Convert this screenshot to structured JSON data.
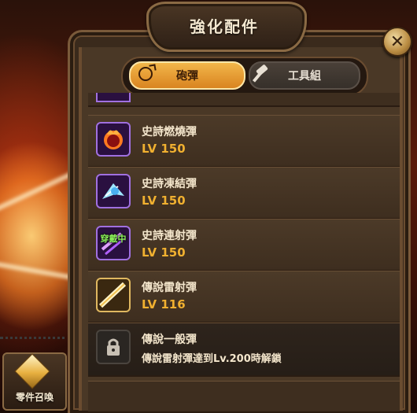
{
  "panel": {
    "title": "強化配件",
    "close_label": "✕"
  },
  "tabs": [
    {
      "label": "砲彈",
      "active": true,
      "icon": "cannonball-icon"
    },
    {
      "label": "工具組",
      "active": false,
      "icon": "hammer-icon"
    }
  ],
  "items": [
    {
      "name": "史詩燃燒彈",
      "level": "LV 150",
      "rarity": "epic",
      "icon": "burning-shell-icon"
    },
    {
      "name": "史詩凍結彈",
      "level": "LV 150",
      "rarity": "epic",
      "icon": "freezing-shell-icon"
    },
    {
      "name": "史詩連射彈",
      "level": "LV 150",
      "rarity": "epic",
      "icon": "rapid-shell-icon",
      "badge": "穿戴中"
    },
    {
      "name": "傳說雷射彈",
      "level": "LV 116",
      "rarity": "legendary",
      "icon": "laser-shell-icon"
    },
    {
      "name": "傳說一般彈",
      "note": "傳說雷射彈達到Lv.200時解鎖",
      "locked": true,
      "icon": "lock-icon"
    }
  ],
  "summon": {
    "label": "零件召喚",
    "icon": "crystal-icon"
  },
  "colors": {
    "accent": "#f0b030",
    "tab_active": "#e59a30",
    "epic_border": "#a070e0",
    "legendary_border": "#e0b860"
  }
}
